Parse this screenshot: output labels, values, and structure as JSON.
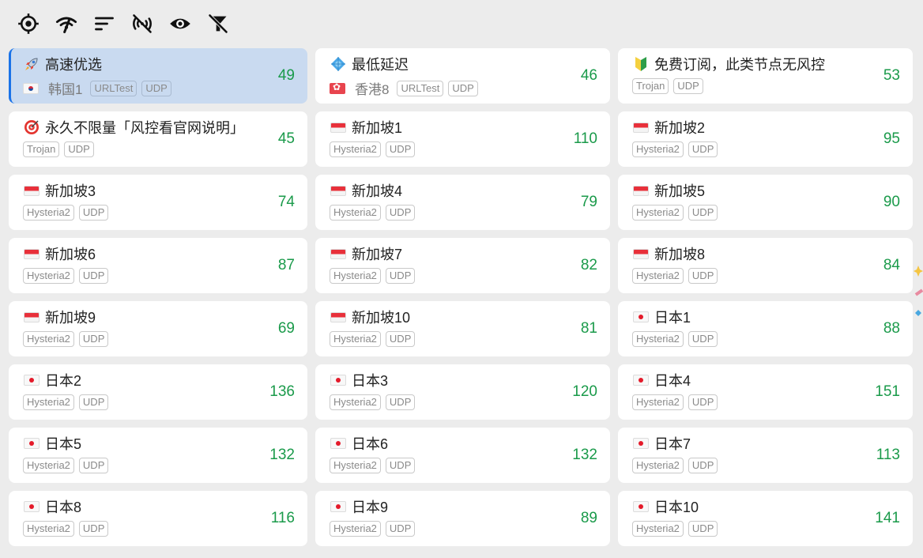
{
  "toolbar": {
    "buttons": [
      {
        "icon": "target-icon"
      },
      {
        "icon": "signal-icon"
      },
      {
        "icon": "sort-icon"
      },
      {
        "icon": "no-signal-icon"
      },
      {
        "icon": "eye-icon"
      },
      {
        "icon": "filter-off-icon"
      }
    ]
  },
  "colors": {
    "selected_bg": "#c9daf0",
    "accent": "#1b73e8",
    "latency": "#1a9a4a",
    "page_bg": "#ececec"
  },
  "proxies": [
    {
      "name": "高速优选",
      "icon": "rocket-icon",
      "sub_flag": "kr",
      "sub_name": "韩国1",
      "tags": [
        "URLTest",
        "UDP"
      ],
      "latency": "49",
      "selected": true
    },
    {
      "name": "最低延迟",
      "icon": "diamond-icon",
      "sub_flag": "hk",
      "sub_name": "香港8",
      "tags": [
        "URLTest",
        "UDP"
      ],
      "latency": "46"
    },
    {
      "name": "免费订阅，此类节点无风控",
      "icon": "beginner-icon",
      "tags": [
        "Trojan",
        "UDP"
      ],
      "latency": "53"
    },
    {
      "name": "永久不限量「风控看官网说明」",
      "icon": "target-dart-icon",
      "tags": [
        "Trojan",
        "UDP"
      ],
      "latency": "45"
    },
    {
      "name": "新加坡1",
      "icon": "flag-sg",
      "tags": [
        "Hysteria2",
        "UDP"
      ],
      "latency": "110"
    },
    {
      "name": "新加坡2",
      "icon": "flag-sg",
      "tags": [
        "Hysteria2",
        "UDP"
      ],
      "latency": "95"
    },
    {
      "name": "新加坡3",
      "icon": "flag-sg",
      "tags": [
        "Hysteria2",
        "UDP"
      ],
      "latency": "74"
    },
    {
      "name": "新加坡4",
      "icon": "flag-sg",
      "tags": [
        "Hysteria2",
        "UDP"
      ],
      "latency": "79"
    },
    {
      "name": "新加坡5",
      "icon": "flag-sg",
      "tags": [
        "Hysteria2",
        "UDP"
      ],
      "latency": "90"
    },
    {
      "name": "新加坡6",
      "icon": "flag-sg",
      "tags": [
        "Hysteria2",
        "UDP"
      ],
      "latency": "87"
    },
    {
      "name": "新加坡7",
      "icon": "flag-sg",
      "tags": [
        "Hysteria2",
        "UDP"
      ],
      "latency": "82"
    },
    {
      "name": "新加坡8",
      "icon": "flag-sg",
      "tags": [
        "Hysteria2",
        "UDP"
      ],
      "latency": "84"
    },
    {
      "name": "新加坡9",
      "icon": "flag-sg",
      "tags": [
        "Hysteria2",
        "UDP"
      ],
      "latency": "69"
    },
    {
      "name": "新加坡10",
      "icon": "flag-sg",
      "tags": [
        "Hysteria2",
        "UDP"
      ],
      "latency": "81"
    },
    {
      "name": "日本1",
      "icon": "flag-jp",
      "tags": [
        "Hysteria2",
        "UDP"
      ],
      "latency": "88"
    },
    {
      "name": "日本2",
      "icon": "flag-jp",
      "tags": [
        "Hysteria2",
        "UDP"
      ],
      "latency": "136"
    },
    {
      "name": "日本3",
      "icon": "flag-jp",
      "tags": [
        "Hysteria2",
        "UDP"
      ],
      "latency": "120"
    },
    {
      "name": "日本4",
      "icon": "flag-jp",
      "tags": [
        "Hysteria2",
        "UDP"
      ],
      "latency": "151"
    },
    {
      "name": "日本5",
      "icon": "flag-jp",
      "tags": [
        "Hysteria2",
        "UDP"
      ],
      "latency": "132"
    },
    {
      "name": "日本6",
      "icon": "flag-jp",
      "tags": [
        "Hysteria2",
        "UDP"
      ],
      "latency": "132"
    },
    {
      "name": "日本7",
      "icon": "flag-jp",
      "tags": [
        "Hysteria2",
        "UDP"
      ],
      "latency": "113"
    },
    {
      "name": "日本8",
      "icon": "flag-jp",
      "tags": [
        "Hysteria2",
        "UDP"
      ],
      "latency": "116"
    },
    {
      "name": "日本9",
      "icon": "flag-jp",
      "tags": [
        "Hysteria2",
        "UDP"
      ],
      "latency": "89"
    },
    {
      "name": "日本10",
      "icon": "flag-jp",
      "tags": [
        "Hysteria2",
        "UDP"
      ],
      "latency": "141"
    }
  ]
}
